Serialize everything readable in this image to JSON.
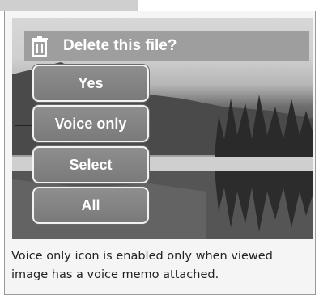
{
  "dialog": {
    "title": "Delete this file?",
    "icon": "trash-icon"
  },
  "buttons": [
    {
      "label": "Yes"
    },
    {
      "label": "Voice only"
    },
    {
      "label": "Select"
    },
    {
      "label": "All"
    }
  ],
  "caption": "Voice only icon is enabled only when viewed image has a voice memo attached."
}
